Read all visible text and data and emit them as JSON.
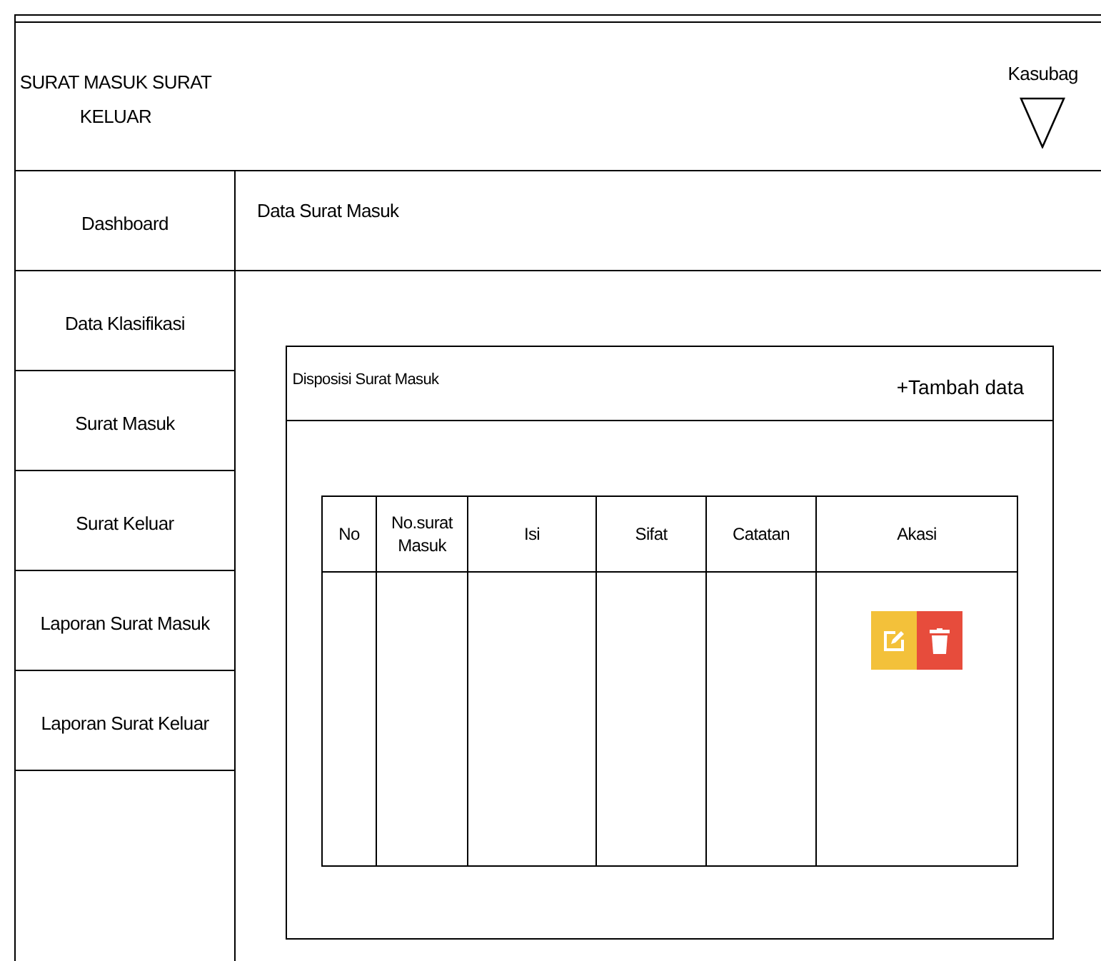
{
  "header": {
    "title": "SURAT  MASUK SURAT KELUAR",
    "user": "Kasubag"
  },
  "sidebar": {
    "items": [
      {
        "label": "Dashboard"
      },
      {
        "label": "Data Klasifikasi"
      },
      {
        "label": "Surat Masuk"
      },
      {
        "label": "Surat Keluar"
      },
      {
        "label": "Laporan Surat Masuk"
      },
      {
        "label": "Laporan Surat Keluar"
      }
    ]
  },
  "page_title": "Data Surat Masuk",
  "card": {
    "title": "Disposisi Surat Masuk",
    "add_button": "+Tambah data"
  },
  "table": {
    "columns": [
      "No",
      "No.surat Masuk",
      "Isi",
      "Sifat",
      "Catatan",
      "Akasi"
    ],
    "rows": [
      {
        "actions": [
          {
            "kind": "edit",
            "color": "#f3c13a"
          },
          {
            "kind": "delete",
            "color": "#e74c3c"
          }
        ]
      }
    ]
  }
}
